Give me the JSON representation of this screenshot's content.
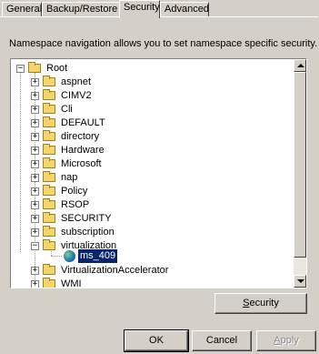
{
  "tabs": [
    {
      "label": "General",
      "active": false
    },
    {
      "label": "Backup/Restore",
      "active": false
    },
    {
      "label": "Security",
      "active": true
    },
    {
      "label": "Advanced",
      "active": false
    }
  ],
  "description": "Namespace navigation allows you to set namespace specific security.",
  "tree": {
    "root": {
      "label": "Root",
      "expander": "−"
    },
    "children": [
      {
        "label": "aspnet",
        "expander": "+"
      },
      {
        "label": "CIMV2",
        "expander": "+"
      },
      {
        "label": "Cli",
        "expander": "+"
      },
      {
        "label": "DEFAULT",
        "expander": "+"
      },
      {
        "label": "directory",
        "expander": "+"
      },
      {
        "label": "Hardware",
        "expander": "+"
      },
      {
        "label": "Microsoft",
        "expander": "+"
      },
      {
        "label": "nap",
        "expander": "+"
      },
      {
        "label": "Policy",
        "expander": "+"
      },
      {
        "label": "RSOP",
        "expander": "+"
      },
      {
        "label": "SECURITY",
        "expander": "+"
      },
      {
        "label": "subscription",
        "expander": "+"
      },
      {
        "label": "virtualization",
        "expander": "−"
      },
      {
        "label": "VirtualizationAccelerator",
        "expander": "+"
      },
      {
        "label": "WMI",
        "expander": "+"
      }
    ],
    "selected_grandchild": {
      "label": "ms_409",
      "icon": "globe-icon"
    }
  },
  "buttons": {
    "security": {
      "mnemonic": "S",
      "rest": "ecurity"
    },
    "ok": "OK",
    "cancel": "Cancel",
    "apply": {
      "mnemonic": "A",
      "rest": "pply"
    }
  }
}
